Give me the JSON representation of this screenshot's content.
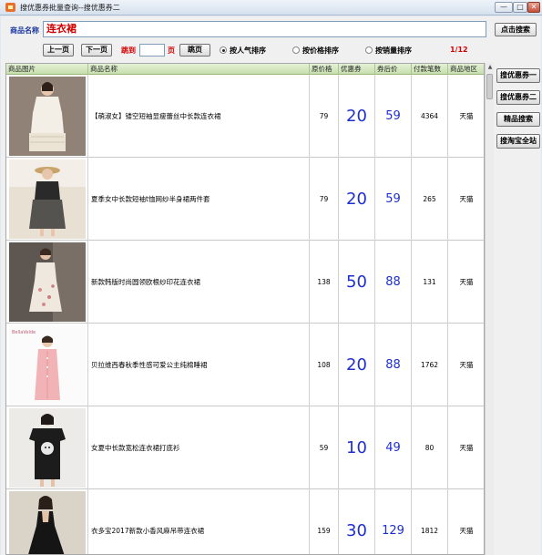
{
  "window": {
    "title": "搜优惠券批量查询--搜优惠券二",
    "min_glyph": "—",
    "max_glyph": "□",
    "close_glyph": "✕"
  },
  "search": {
    "label": "商品名称",
    "value": "连衣裙",
    "button_label": "点击搜索"
  },
  "pager": {
    "prev_label": "上一页",
    "next_label": "下一页",
    "jump_label": "跳到",
    "page_input_value": "",
    "page_suffix": "页",
    "go_label": "跳页",
    "page_count": "1/12"
  },
  "sort": {
    "options": [
      {
        "label": "按人气排序",
        "selected": true
      },
      {
        "label": "按价格排序",
        "selected": false
      },
      {
        "label": "按销量排序",
        "selected": false
      }
    ]
  },
  "table": {
    "columns": [
      "商品图片",
      "商品名称",
      "原价格",
      "优惠券",
      "券后价",
      "付款笔数",
      "商品地区"
    ],
    "rows": [
      {
        "name": "【萌淑女】镂空短袖显瘦蕾丝中长款连衣裙",
        "price": "79",
        "coupon": "20",
        "after": "59",
        "payments": "4364",
        "region": "天猫"
      },
      {
        "name": "夏季女中长款短袖t恤网纱半身裙两件套",
        "price": "79",
        "coupon": "20",
        "after": "59",
        "payments": "265",
        "region": "天猫"
      },
      {
        "name": "新款韩版时尚圆领欧根纱印花连衣裙",
        "price": "138",
        "coupon": "50",
        "after": "88",
        "payments": "131",
        "region": "天猫"
      },
      {
        "name": "贝拉维西春秋季性感可爱公主纯棉睡裙",
        "price": "108",
        "coupon": "20",
        "after": "88",
        "payments": "1762",
        "region": "天猫"
      },
      {
        "name": "女夏中长款宽松连衣裙打底衫",
        "price": "59",
        "coupon": "10",
        "after": "49",
        "payments": "80",
        "region": "天猫"
      },
      {
        "name": "衣多宝2017新款小香风麻吊带连衣裙",
        "price": "159",
        "coupon": "30",
        "after": "129",
        "payments": "1812",
        "region": "天猫"
      }
    ]
  },
  "sidebar": {
    "buttons": [
      "搜优惠券一",
      "搜优惠券二",
      "精品搜索",
      "搜淘宝全站"
    ]
  },
  "thumb_text": {
    "row3_brand": "BellaVelde"
  },
  "colors": {
    "search_value": "#d40000",
    "coupon_blue": "#1e2fd2",
    "header_green": "#c7dfae"
  }
}
